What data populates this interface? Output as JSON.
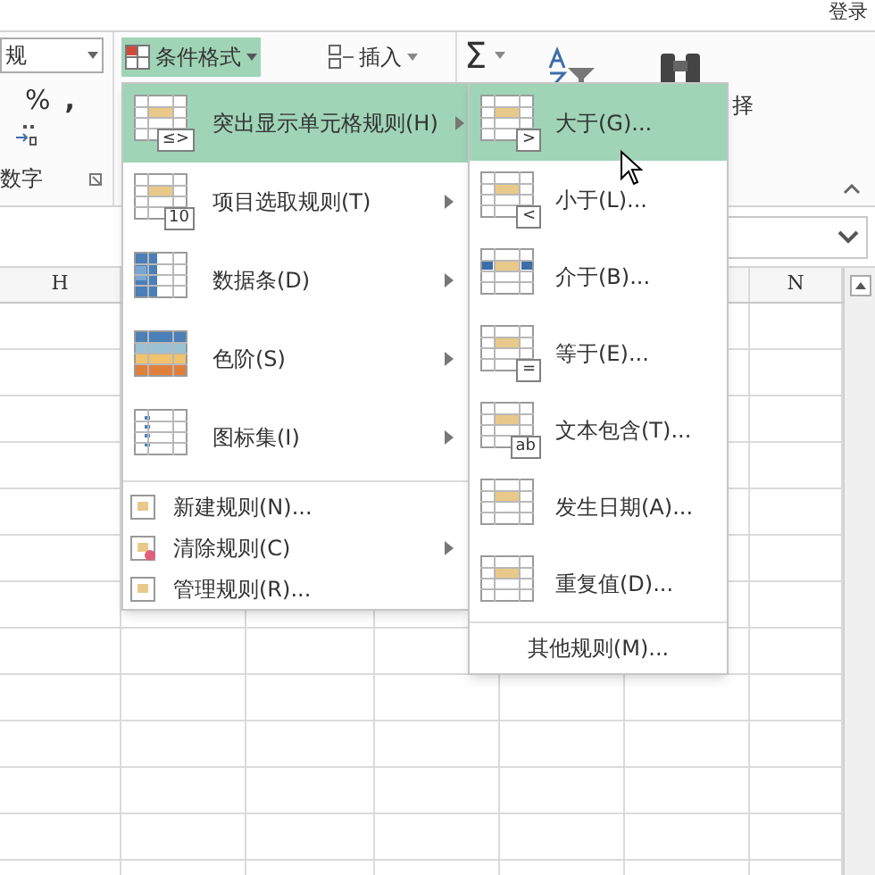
{
  "top_bar": {
    "login_link": "登录"
  },
  "ribbon": {
    "number_format": {
      "value": "规"
    },
    "percent_button": "%",
    "comma_button": ",",
    "number_group_label": "数字",
    "conditional_format_button": {
      "label": "条件格式",
      "selected": true
    },
    "insert_button": "插入",
    "sum_button": "Σ",
    "find_select_label": "择"
  },
  "sheet": {
    "column_headers": [
      "H",
      "N"
    ]
  },
  "menu": {
    "items": [
      {
        "kind": "large",
        "label": "突出显示单元格规则(H)",
        "badge": "≤>",
        "submenu": true,
        "selected": true
      },
      {
        "kind": "large",
        "label": "项目选取规则(T)",
        "badge": "10",
        "submenu": true,
        "selected": false
      },
      {
        "kind": "large",
        "label": "数据条(D)",
        "submenu": true,
        "selected": false
      },
      {
        "kind": "large",
        "label": "色阶(S)",
        "submenu": true,
        "selected": false
      },
      {
        "kind": "large",
        "label": "图标集(I)",
        "submenu": true,
        "selected": false
      },
      {
        "kind": "small",
        "label": "新建规则(N)...",
        "submenu": false,
        "selected": false
      },
      {
        "kind": "small",
        "label": "清除规则(C)",
        "submenu": true,
        "selected": false
      },
      {
        "kind": "small",
        "label": "管理规则(R)...",
        "submenu": false,
        "selected": false
      }
    ]
  },
  "submenu": {
    "items": [
      {
        "label": "大于(G)...",
        "badge": ">",
        "selected": true
      },
      {
        "label": "小于(L)...",
        "badge": "<",
        "selected": false
      },
      {
        "label": "介于(B)...",
        "selected": false
      },
      {
        "label": "等于(E)...",
        "badge": "=",
        "selected": false
      },
      {
        "label": "文本包含(T)...",
        "badge": "ab",
        "selected": false
      },
      {
        "label": "发生日期(A)...",
        "selected": false
      },
      {
        "label": "重复值(D)...",
        "selected": false
      }
    ],
    "footer": "其他规则(M)..."
  }
}
